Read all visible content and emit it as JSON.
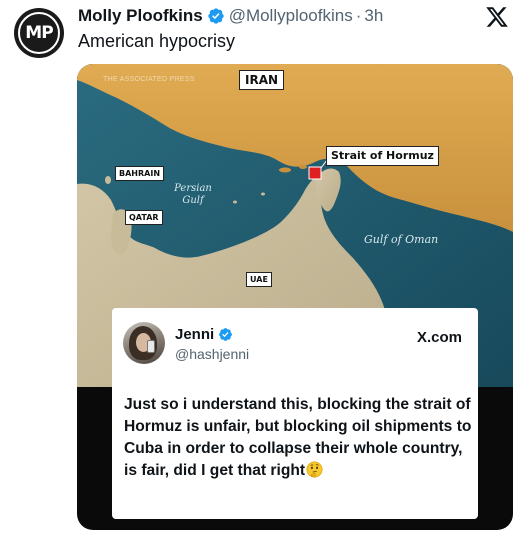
{
  "author": {
    "initials": "MP",
    "display_name": "Molly Ploofkins",
    "handle": "@Mollyploofkins",
    "separator": "·",
    "time": "3h",
    "verified_color": "#1d9bf0"
  },
  "tweet": {
    "text": "American hypocrisy"
  },
  "icons": {
    "platform_logo": "x-logo-icon",
    "verified": "verified-badge-icon",
    "thinking_emoji": "thinking-face-icon"
  },
  "media": {
    "map": {
      "watermark": "THE ASSOCIATED PRESS",
      "labels": {
        "iran": "IRAN",
        "strait": "Strait of Hormuz",
        "bahrain": "BAHRAIN",
        "qatar": "QATAR",
        "uae": "UAE",
        "persian_gulf": "Persian Gulf",
        "gulf_of_oman": "Gulf of Oman"
      },
      "colors": {
        "land": "#d9a54e",
        "water": "#1f5a6e",
        "marker": "#e02020"
      }
    },
    "quote_card": {
      "name": "Jenni",
      "handle": "@hashjenni",
      "brand": "X.com",
      "body": "Just so i understand this, blocking the strait of Hormuz is unfair, but blocking oil shipments to Cuba in order to collapse their whole country, is fair, did I get that right"
    }
  }
}
